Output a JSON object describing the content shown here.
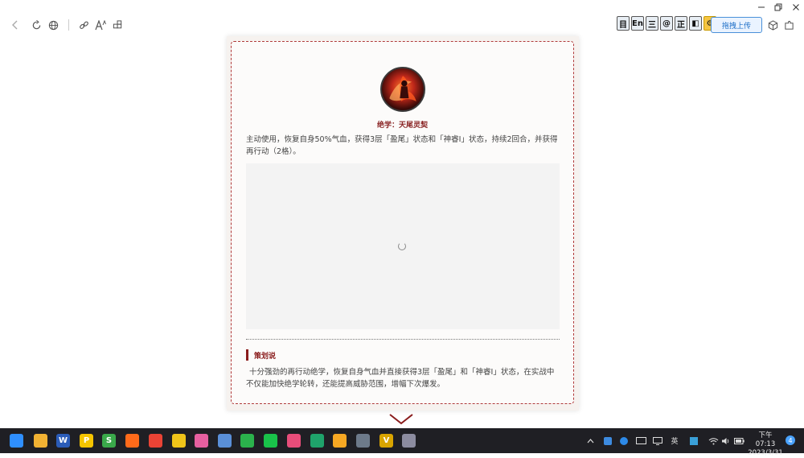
{
  "toolbar": {
    "ime_keys": [
      "目",
      "En",
      "三",
      "@",
      "正",
      "◧",
      "⚙"
    ],
    "upload_label": "拖拽上传"
  },
  "card": {
    "skill_title": "绝学：天尾灵契",
    "skill_desc": "主动使用，恢复自身50%气血，获得3层「盈尾」状态和「神睿I」状态，持续2回合，并获得再行动（2格）。",
    "section_title": "策划说",
    "section_text": "十分强劲的再行动绝学，恢复自身气血并直接获得3层「盈尾」和「神睿I」状态，在实战中不仅能加快绝学轮转，还能提高威胁范围，增幅下次爆发。"
  },
  "taskbar": {
    "apps": [
      {
        "name": "start-icon",
        "label": "",
        "color": "#2f8fff"
      },
      {
        "name": "file-explorer-icon",
        "label": "",
        "color": "#f2b233"
      },
      {
        "name": "word-icon",
        "label": "W",
        "color": "#2b5cb8"
      },
      {
        "name": "app-p-icon",
        "label": "P",
        "color": "#f5c400"
      },
      {
        "name": "app-s-icon",
        "label": "S",
        "color": "#3aa84a"
      },
      {
        "name": "firefox-icon",
        "label": "",
        "color": "#ff6a1a"
      },
      {
        "name": "chrome-icon",
        "label": "",
        "color": "#ea4335"
      },
      {
        "name": "app-tag-icon",
        "label": "",
        "color": "#f0c419"
      },
      {
        "name": "app-pink-icon",
        "label": "",
        "color": "#e65fa0"
      },
      {
        "name": "app-window-icon",
        "label": "",
        "color": "#5a8fd8"
      },
      {
        "name": "wechat-icon",
        "label": "",
        "color": "#2bb24c"
      },
      {
        "name": "line-icon",
        "label": "",
        "color": "#19c24a"
      },
      {
        "name": "app-pink2-icon",
        "label": "",
        "color": "#e84d7a"
      },
      {
        "name": "edge-icon",
        "label": "",
        "color": "#1fa36b"
      },
      {
        "name": "weather-icon",
        "label": "",
        "color": "#f7a823"
      },
      {
        "name": "calculator-icon",
        "label": "",
        "color": "#6d7a8a"
      },
      {
        "name": "app-v-icon",
        "label": "V",
        "color": "#d9a400"
      },
      {
        "name": "app-photo-icon",
        "label": "",
        "color": "#8c8ca0"
      }
    ],
    "ime_label": "英",
    "clock_period_time": "下午 07:13",
    "clock_date": "2023/3/31",
    "notification_count": "4"
  }
}
